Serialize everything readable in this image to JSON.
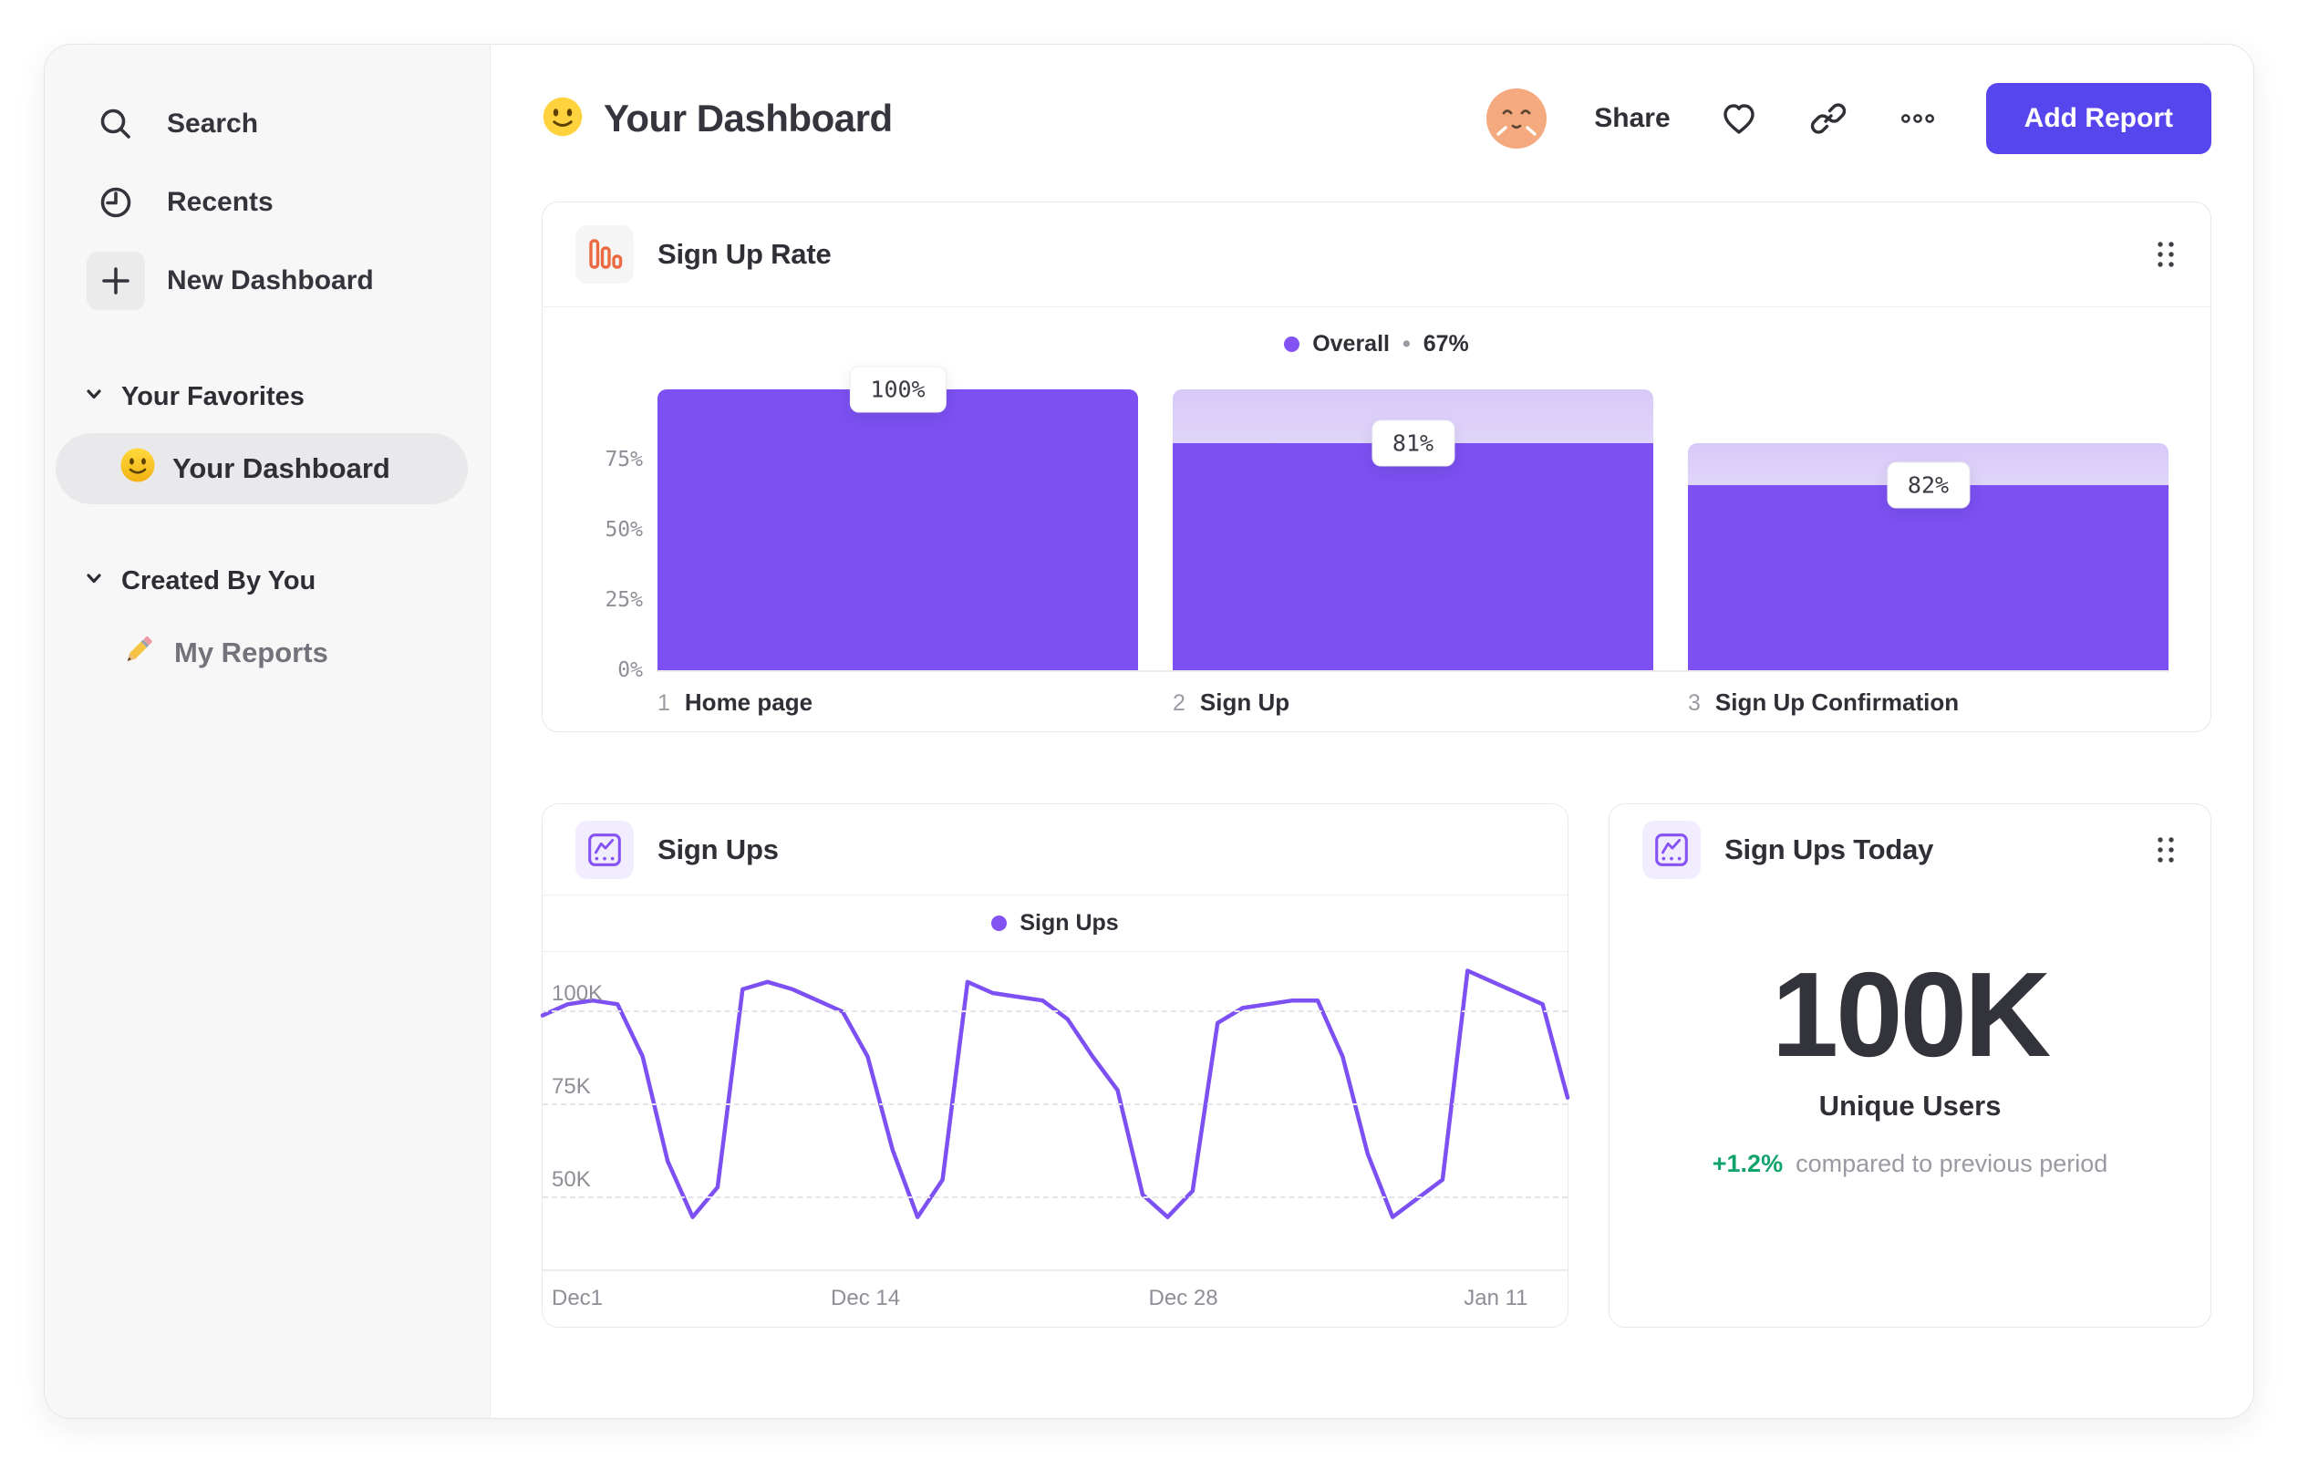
{
  "sidebar": {
    "items": [
      {
        "label": "Search",
        "icon": "search-icon"
      },
      {
        "label": "Recents",
        "icon": "clock-icon"
      },
      {
        "label": "New Dashboard",
        "icon": "plus-icon"
      }
    ],
    "sections": [
      {
        "label": "Your Favorites",
        "icon": "chevron-down-icon",
        "children": [
          {
            "label": "Your Dashboard",
            "icon": "smiley-emoji",
            "selected": true
          }
        ]
      },
      {
        "label": "Created By You",
        "icon": "chevron-down-icon",
        "children": [
          {
            "label": "My Reports",
            "icon": "pencil-emoji",
            "selected": false
          }
        ]
      }
    ]
  },
  "header": {
    "title": "Your Dashboard",
    "title_emoji": "smiley-emoji",
    "avatar": "user-avatar",
    "share_label": "Share",
    "icons": [
      "heart-icon",
      "link-icon",
      "more-dots-icon"
    ],
    "add_report_label": "Add Report"
  },
  "cards": {
    "signup_rate": {
      "title": "Sign Up Rate",
      "icon": "bar-chart-icon",
      "legend_label": "Overall",
      "legend_sep": "•",
      "legend_value": "67%"
    },
    "signups": {
      "title": "Sign Ups",
      "icon": "line-chart-icon",
      "legend_label": "Sign Ups"
    },
    "signups_today": {
      "title": "Sign Ups Today",
      "icon": "line-chart-icon",
      "value": "100K",
      "metric_label": "Unique Users",
      "delta": "+1.2%",
      "delta_note": "compared to previous period"
    }
  },
  "chart_data": [
    {
      "type": "bar",
      "variant": "funnel",
      "title": "Sign Up Rate",
      "legend": [
        {
          "name": "Overall",
          "value": "67%"
        }
      ],
      "legend_position": "top-center",
      "categories": [
        "Home page",
        "Sign Up",
        "Sign Up Confirmation"
      ],
      "steps": [
        {
          "index": "1",
          "label": "Home page",
          "badge": "100%",
          "conversion_from_previous_pct": 100,
          "overall_pct": 100,
          "ghost_pct": 100
        },
        {
          "index": "2",
          "label": "Sign Up",
          "badge": "81%",
          "conversion_from_previous_pct": 81,
          "overall_pct": 81,
          "ghost_pct": 100
        },
        {
          "index": "3",
          "label": "Sign Up Confirmation",
          "badge": "82%",
          "conversion_from_previous_pct": 82,
          "overall_pct": 66,
          "ghost_pct": 81
        }
      ],
      "yticks": [
        {
          "label": "75%",
          "value": 75
        },
        {
          "label": "50%",
          "value": 50
        },
        {
          "label": "25%",
          "value": 25
        },
        {
          "label": "0%",
          "value": 0
        }
      ],
      "ylim": [
        0,
        100
      ],
      "grid": false
    },
    {
      "type": "line",
      "title": "Sign Ups",
      "legend": [
        {
          "name": "Sign Ups"
        }
      ],
      "legend_position": "top-center",
      "x_tick_labels": [
        "Dec1",
        "Dec 14",
        "Dec 28",
        "Jan 11"
      ],
      "x_tick_positions_pct": [
        0,
        31.5,
        62.5,
        93
      ],
      "x_range_days": 42,
      "yticks": [
        {
          "label": "100K",
          "value": 100
        },
        {
          "label": "75K",
          "value": 75
        },
        {
          "label": "50K",
          "value": 50
        }
      ],
      "ylim": [
        31,
        116
      ],
      "unit": "K users",
      "grid": "horizontal-dashed",
      "series": [
        {
          "name": "Sign Ups",
          "values_k": [
            99,
            102,
            103,
            102,
            88,
            60,
            45,
            53,
            106,
            108,
            106,
            103,
            100,
            88,
            63,
            45,
            55,
            108,
            105,
            104,
            103,
            98,
            88,
            79,
            51,
            45,
            52,
            97,
            101,
            102,
            103,
            103,
            88,
            62,
            45,
            50,
            55,
            111,
            108,
            105,
            102,
            77
          ]
        }
      ]
    },
    {
      "type": "metric",
      "title": "Sign Ups Today",
      "value": "100K",
      "label": "Unique Users",
      "delta_pct": 1.2,
      "delta_text": "+1.2%",
      "comparison": "compared to previous period",
      "trend": "up"
    }
  ],
  "colors": {
    "accent_purple": "#7c50f2",
    "legend_dot_purple": "#8352f3",
    "button_purple": "#5746ee",
    "icon_purple": "#8452f5",
    "icon_purple_bg": "#f2edfe",
    "icon_orange": "#ec6a41",
    "ghost_gradient_top": "#d7c9f8",
    "green_positive": "#10a36c",
    "avatar_skin": "#f4a97e",
    "sidebar_bg": "#f7f7f8",
    "text_dark": "#2f2f36",
    "text_gray": "#8e8e96"
  }
}
